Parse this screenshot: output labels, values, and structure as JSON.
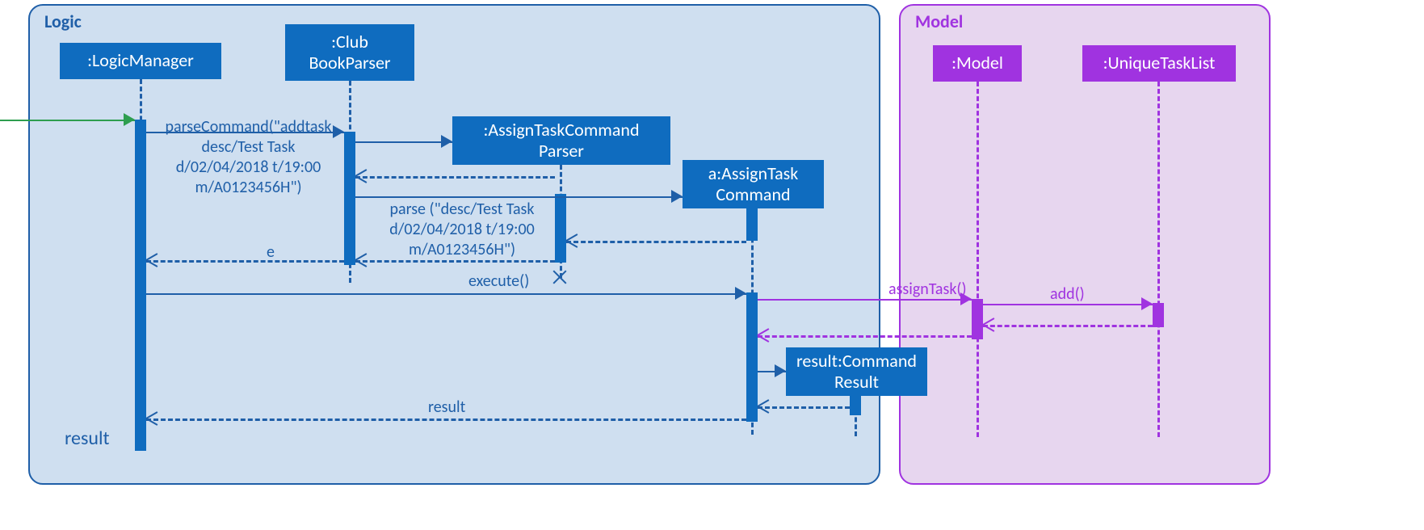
{
  "frames": {
    "logic": "Logic",
    "model": "Model"
  },
  "participants": {
    "logicManager": ":LogicManager",
    "clubBookParser": ":Club\nBookParser",
    "assignTaskCommandParser": ":AssignTaskCommand\nParser",
    "assignTaskCommand": "a:AssignTask\nCommand",
    "commandResult": "result:Command\nResult",
    "model": ":Model",
    "uniqueTaskList": ":UniqueTaskList"
  },
  "messages": {
    "parseCommand": "parseCommand(\"addtask\ndesc/Test Task\nd/02/04/2018 t/19:00\nm/A0123456H\")",
    "parse": "parse (\"desc/Test Task\nd/02/04/2018 t/19:00\nm/A0123456H\")",
    "e": "e",
    "execute": "execute()",
    "assignTask": "assignTask()",
    "add": "add()",
    "resultReturn": "result",
    "resultOut": "result"
  },
  "colors": {
    "blue": "#0f6cbf",
    "purple": "#a033e0",
    "green": "#2e9e4f",
    "logicBg": "#cfdff0",
    "modelBg": "#e7d6ef"
  }
}
